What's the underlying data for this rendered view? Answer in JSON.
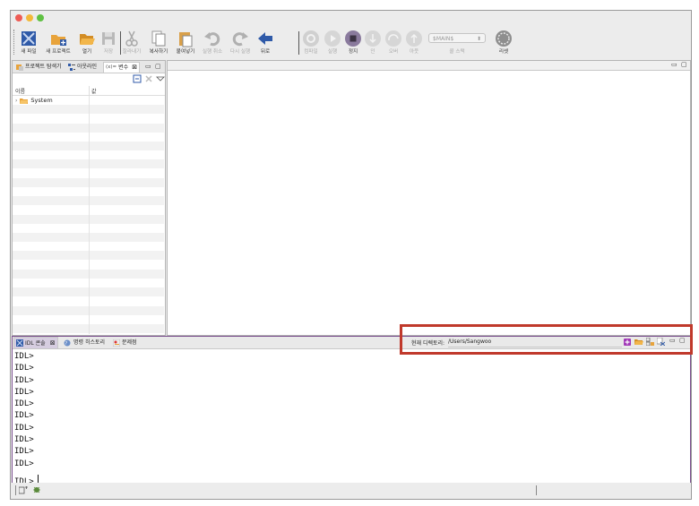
{
  "toolbar": {
    "new_file": "새 파일",
    "new_project": "새 프로젝트",
    "open": "열기",
    "save": "저장",
    "cut": "잘라내기",
    "copy": "복사하기",
    "paste": "붙여넣기",
    "undo": "실행 취소",
    "redo": "다시 실행",
    "back": "뒤로",
    "compile": "컴파일",
    "run": "실행",
    "stop": "정지",
    "step_in": "인",
    "step_over": "오버",
    "step_out": "아웃",
    "main_select_value": "$MAIN$",
    "call_stack_label": "콜 스택",
    "reset": "리셋"
  },
  "left_panel": {
    "tabs": [
      "프로젝트 탐색기",
      "아웃라인",
      "변수"
    ],
    "var_tab_prefix": "(x)=",
    "columns": [
      "이름",
      "값"
    ],
    "tree_item": "System"
  },
  "console": {
    "tabs": [
      "IDL 콘솔",
      "명령 히스토리",
      "문제점"
    ],
    "current_dir_label": "현재 디렉토리:",
    "current_dir_value": "/Users/Sangwoo",
    "lines": [
      "IDL>",
      "IDL>",
      "IDL>",
      "IDL>",
      "IDL>",
      "IDL>",
      "IDL>",
      "IDL>",
      "IDL>",
      "IDL>",
      "IDL>"
    ]
  },
  "colors": {
    "highlight_box": "#c0392b",
    "console_border": "#7b4f8e",
    "accent_blue": "#2f5aa8",
    "folder": "#e8a33b"
  }
}
